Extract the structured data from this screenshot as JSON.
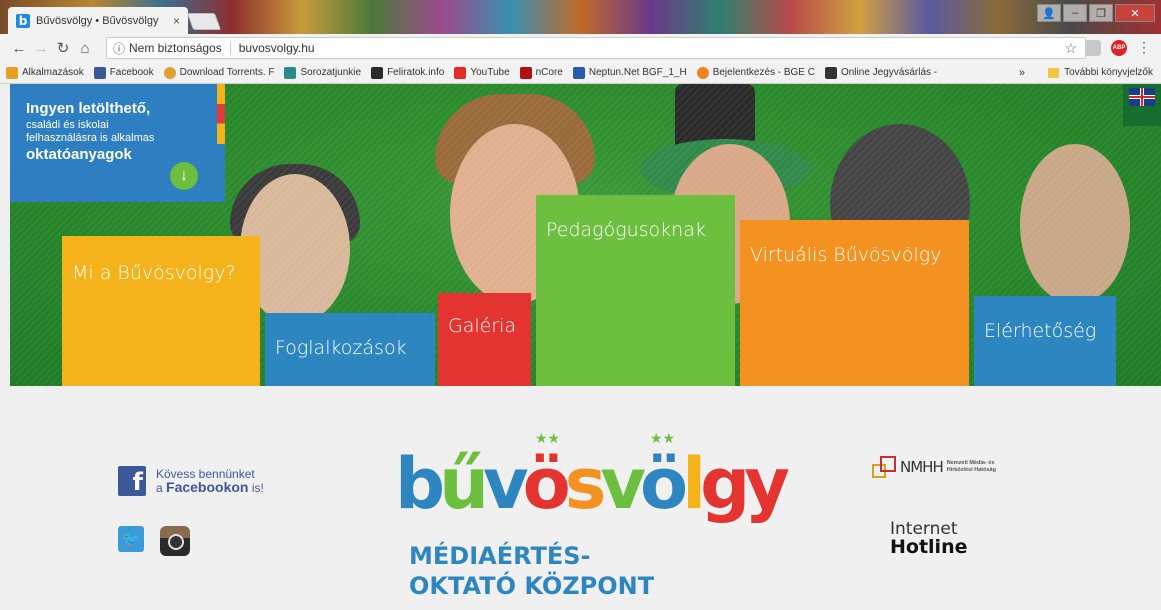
{
  "browser": {
    "tab_title": "Bűvösvölgy • Bűvösvölgy",
    "tab_favicon": "b",
    "tab_close": "×",
    "security_label": "Nem biztonságos",
    "url": "buvosvolgy.hu",
    "bookmarks": [
      {
        "label": "Alkalmazások",
        "icon": "apps-icon",
        "color": "#e8a020"
      },
      {
        "label": "Facebook",
        "icon": "facebook-icon",
        "color": "#3b5998"
      },
      {
        "label": "Download Torrents. F",
        "icon": "torrent-icon",
        "color": "#e0a030"
      },
      {
        "label": "Sorozatjunkie",
        "icon": "tv-icon",
        "color": "#2a8a8a"
      },
      {
        "label": "Feliratok.info",
        "icon": "subtitle-icon",
        "color": "#2a2a2a"
      },
      {
        "label": "YouTube",
        "icon": "youtube-icon",
        "color": "#e52d27"
      },
      {
        "label": "nCore",
        "icon": "ncore-icon",
        "color": "#b01010"
      },
      {
        "label": "Neptun.Net BGF_1_H",
        "icon": "neptun-icon",
        "color": "#2a5ab0"
      },
      {
        "label": "Bejelentkezés - BGE C",
        "icon": "moodle-icon",
        "color": "#f08020"
      },
      {
        "label": "Online Jegyvásárlás -",
        "icon": "ticket-icon",
        "color": "#333333"
      }
    ],
    "bookmarks_more": "»",
    "other_bookmarks": "További könyvjelzők",
    "abp_label": "ABP"
  },
  "hero": {
    "promo": {
      "line1": "Ingyen letölthető,",
      "line2": "családi és iskolai",
      "line3": "felhasználásra is alkalmas",
      "line4": "oktatóanyagok"
    },
    "tiles": {
      "mi": "Mi a Bűvösvölgy?",
      "foglalkozasok": "Foglalkozások",
      "galeria": "Galéria",
      "pedagogusoknak": "Pedagógusoknak",
      "virtualis": "Virtuális Bűvösvölgy",
      "elerhetoseg": "Elérhetőség"
    }
  },
  "footer": {
    "facebook_line1": "Kövess bennünket",
    "facebook_prefix": "a ",
    "facebook_bold": "Facebookon",
    "facebook_suffix": " is!",
    "logo_letters": [
      "b",
      "ű",
      "v",
      "ö",
      "s",
      "v",
      "ö",
      "l",
      "gy"
    ],
    "logo_sub1": "MÉDIAÉRTÉS-",
    "logo_sub2": "OKTATÓ KÖZPONT",
    "nmhh_abbr": "NMHH",
    "nmhh_full": "Nemzeti Média- és Hírközlési Hatóság",
    "hotline_line1": "Internet",
    "hotline_line2": "Hotline"
  },
  "colors": {
    "blue": "#2e86c1",
    "green": "#6cbf3f",
    "yellow": "#f5b31b",
    "red": "#e3342f",
    "orange": "#f39221"
  }
}
